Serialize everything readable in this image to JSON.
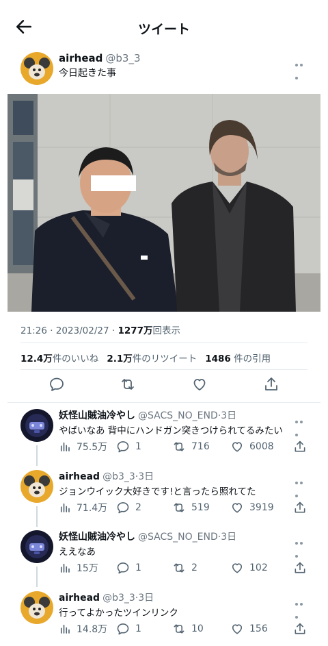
{
  "header": {
    "title": "ツイート"
  },
  "main_tweet": {
    "name": "airhead",
    "handle": "@b3_3",
    "text": "今日起きた事",
    "time": "21:26",
    "date": "2023/02/27",
    "views": "1277万",
    "views_label": "回表示",
    "likes": "12.4万",
    "likes_label": "件のいいね",
    "retweets": "2.1万",
    "retweets_label": "件のリツイート",
    "quotes": "1486",
    "quotes_label": "件の引用"
  },
  "replies": [
    {
      "name": "妖怪山賊油冷やし",
      "handle": "@SACS_NO_END",
      "age": "3日",
      "text": "やばいなあ 背中にハンドガン突きつけられてるみたい",
      "views": "75.5万",
      "replies": "1",
      "retweets": "716",
      "likes": "6008",
      "avatar": "dark"
    },
    {
      "name": "airhead",
      "handle": "@b3_3",
      "age": "3日",
      "text": "ジョンウイック大好きです!と言ったら照れてた",
      "views": "71.4万",
      "replies": "2",
      "retweets": "519",
      "likes": "3919",
      "avatar": "mouse"
    },
    {
      "name": "妖怪山賊油冷やし",
      "handle": "@SACS_NO_END",
      "age": "3日",
      "text": "ええなあ",
      "views": "15万",
      "replies": "1",
      "retweets": "2",
      "likes": "102",
      "avatar": "dark"
    },
    {
      "name": "airhead",
      "handle": "@b3_3",
      "age": "3日",
      "text": "行ってよかったツインリンク",
      "views": "14.8万",
      "replies": "1",
      "retweets": "10",
      "likes": "156",
      "avatar": "mouse"
    }
  ]
}
